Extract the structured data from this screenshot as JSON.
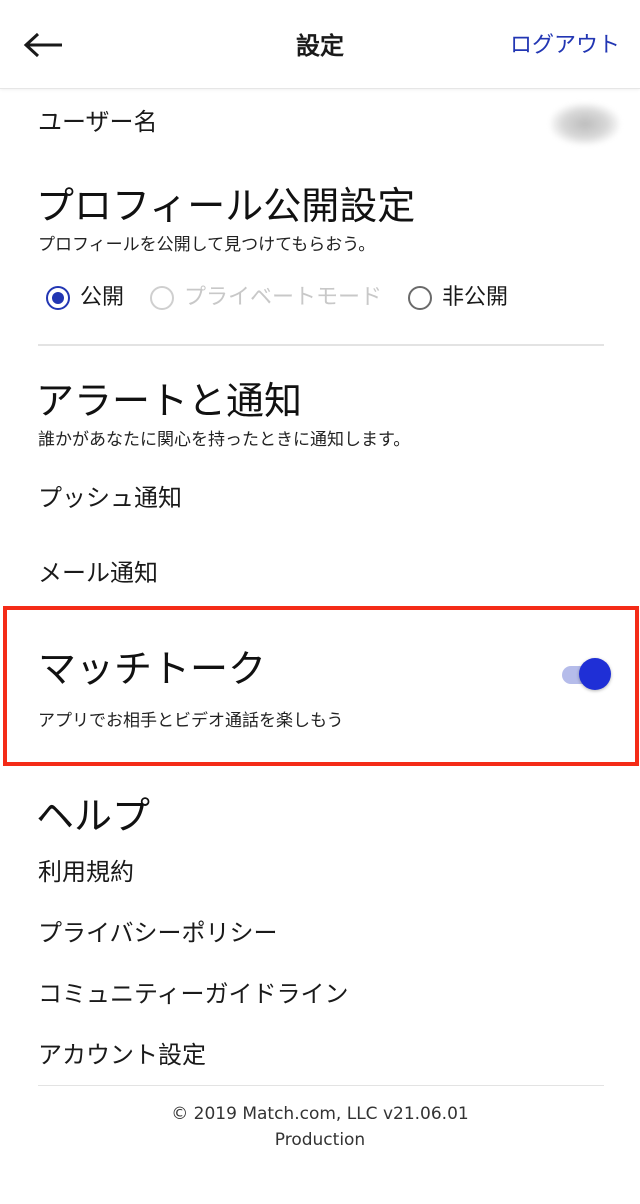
{
  "header": {
    "title": "設定",
    "logout_label": "ログアウト"
  },
  "account": {
    "username_label": "ユーザー名"
  },
  "profile_visibility": {
    "title": "プロフィール公開設定",
    "subtitle": "プロフィールを公開して見つけてもらおう。",
    "options": [
      {
        "label": "公開",
        "state": "selected"
      },
      {
        "label": "プライベートモード",
        "state": "disabled"
      },
      {
        "label": "非公開",
        "state": "unselected"
      }
    ]
  },
  "alerts": {
    "title": "アラートと通知",
    "subtitle": "誰かがあなたに関心を持ったときに通知します。",
    "items": [
      "プッシュ通知",
      "メール通知"
    ]
  },
  "match_talk": {
    "title": "マッチトーク",
    "subtitle": "アプリでお相手とビデオ通話を楽しもう",
    "enabled": true
  },
  "help": {
    "title": "ヘルプ",
    "items": [
      "利用規約",
      "プライバシーポリシー",
      "コミュニティーガイドライン",
      "アカウント設定"
    ]
  },
  "footer": {
    "copyright": "© 2019 Match.com, LLC v21.06.01",
    "environment": "Production"
  },
  "colors": {
    "accent": "#2236b3",
    "toggle_on": "#1f2fd6",
    "highlight_border": "#f42b17"
  },
  "icons": {
    "back": "arrow-left-icon"
  }
}
